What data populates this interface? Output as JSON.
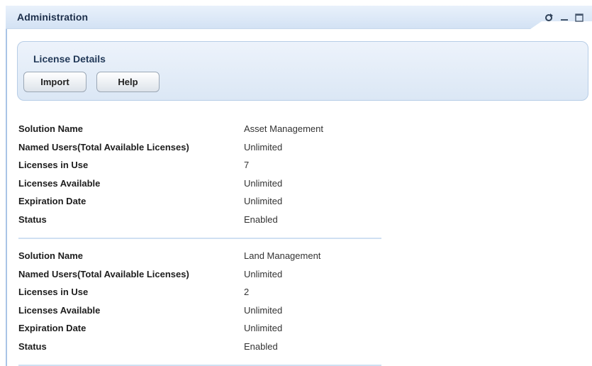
{
  "window": {
    "title": "Administration",
    "controls": [
      "refresh-icon",
      "minimize-icon",
      "maximize-icon"
    ]
  },
  "panel": {
    "title": "License Details",
    "buttons": {
      "import": "Import",
      "help": "Help"
    }
  },
  "licenses": [
    {
      "solution_name": {
        "label": "Solution Name",
        "value": "Asset Management"
      },
      "named_users": {
        "label": "Named Users(Total Available Licenses)",
        "value": "Unlimited"
      },
      "in_use": {
        "label": "Licenses in Use",
        "value": "7"
      },
      "available": {
        "label": "Licenses Available",
        "value": "Unlimited"
      },
      "expiration": {
        "label": "Expiration Date",
        "value": "Unlimited"
      },
      "status": {
        "label": "Status",
        "value": "Enabled"
      }
    },
    {
      "solution_name": {
        "label": "Solution Name",
        "value": "Land Management"
      },
      "named_users": {
        "label": "Named Users(Total Available Licenses)",
        "value": "Unlimited"
      },
      "in_use": {
        "label": "Licenses in Use",
        "value": "2"
      },
      "available": {
        "label": "Licenses Available",
        "value": "Unlimited"
      },
      "expiration": {
        "label": "Expiration Date",
        "value": "Unlimited"
      },
      "status": {
        "label": "Status",
        "value": "Enabled"
      }
    }
  ],
  "colors": {
    "titlebar": "#d3e2f4",
    "panel_border": "#b7cde6",
    "divider": "#cfe0f2",
    "accent_border": "#a9c4e6"
  }
}
